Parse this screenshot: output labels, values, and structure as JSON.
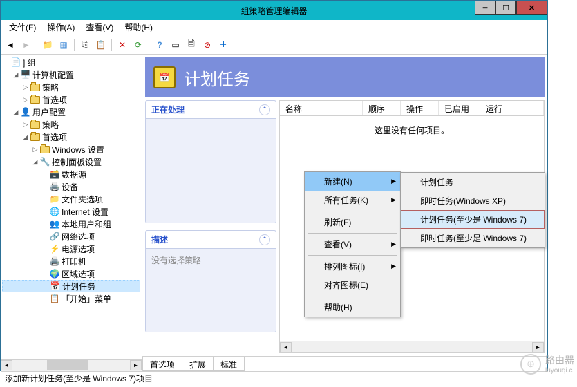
{
  "window": {
    "title": "组策略管理编辑器"
  },
  "menubar": {
    "file": "文件(F)",
    "action": "操作(A)",
    "view": "查看(V)",
    "help": "帮助(H)"
  },
  "tree": {
    "root": "] 组",
    "computer_config": "计算机配置",
    "policies": "策略",
    "preferences": "首选项",
    "user_config": "用户配置",
    "windows_settings": "Windows 设置",
    "control_panel": "控制面板设置",
    "data_sources": "数据源",
    "devices": "设备",
    "folder_options": "文件夹选项",
    "internet_settings": "Internet 设置",
    "local_users": "本地用户和组",
    "network_options": "网络选项",
    "power_options": "电源选项",
    "printers": "打印机",
    "regional_options": "区域选项",
    "scheduled_tasks": "计划任务",
    "start_menu": "「开始」菜单"
  },
  "header": {
    "title": "计划任务"
  },
  "panels": {
    "processing": "正在处理",
    "description": "描述",
    "no_selection": "没有选择策略"
  },
  "grid": {
    "columns": {
      "name": "名称",
      "order": "顺序",
      "action": "操作",
      "enabled": "已启用",
      "run": "运行"
    },
    "empty": "这里没有任何项目。"
  },
  "context_menu": {
    "new": "新建(N)",
    "all_tasks": "所有任务(K)",
    "refresh": "刷新(F)",
    "view": "查看(V)",
    "arrange_icons": "排列图标(I)",
    "align_icons": "对齐图标(E)",
    "help": "帮助(H)"
  },
  "submenu": {
    "scheduled_task": "计划任务",
    "immediate_task_xp": "即时任务(Windows XP)",
    "scheduled_task_win7": "计划任务(至少是 Windows 7)",
    "immediate_task_win7": "即时任务(至少是 Windows 7)"
  },
  "tabs": {
    "preferences": "首选项",
    "extended": "扩展",
    "standard": "标准"
  },
  "statusbar": {
    "text": "添加新计划任务(至少是 Windows 7)项目"
  },
  "watermark": {
    "brand": "路由器",
    "url": "luyouqi.c"
  }
}
